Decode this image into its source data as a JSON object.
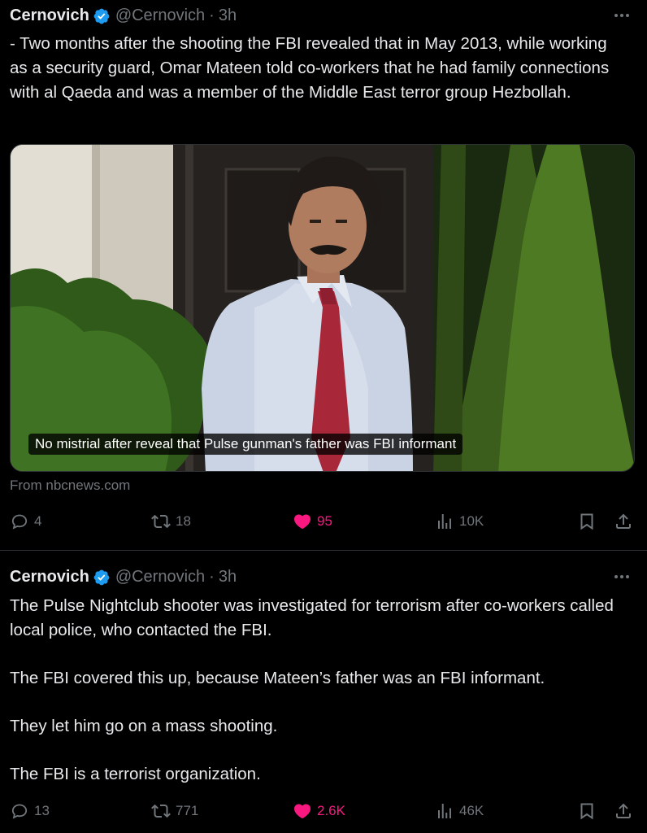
{
  "tweets": [
    {
      "author": {
        "name": "Cernovich",
        "handle": "@Cernovich",
        "separator": "·",
        "time": "3h"
      },
      "text": "- Two months after the shooting the FBI revealed that in May 2013, while working as a security guard, Omar Mateen told co-workers that he had family connections with al Qaeda and was a member of the Middle East terror group Hezbollah.",
      "card": {
        "headline": "No mistrial after reveal that Pulse gunman's father was FBI informant",
        "source": "From nbcnews.com"
      },
      "stats": {
        "replies": "4",
        "retweets": "18",
        "likes": "95",
        "views": "10K"
      }
    },
    {
      "author": {
        "name": "Cernovich",
        "handle": "@Cernovich",
        "separator": "·",
        "time": "3h"
      },
      "paragraphs": [
        "The Pulse Nightclub shooter was investigated for terrorism after co-workers called local police, who contacted the FBI.",
        "The FBI covered this up, because Mateen’s father was an FBI informant.",
        "They let him go on a mass shooting.",
        "The FBI is a terrorist organization."
      ],
      "stats": {
        "replies": "13",
        "retweets": "771",
        "likes": "2.6K",
        "views": "46K"
      }
    }
  ],
  "icons": {
    "verified": "verified-badge-icon",
    "more": "more-horizontal-icon",
    "reply": "reply-bubble-icon",
    "retweet": "retweet-arrows-icon",
    "like": "heart-filled-icon",
    "views": "views-bar-chart-icon",
    "bookmark": "bookmark-icon",
    "share": "share-upload-icon"
  },
  "colors": {
    "background": "#000000",
    "text": "#e7e9ea",
    "muted": "#71767b",
    "verified": "#1d9bf0",
    "like": "#f91880",
    "divider": "#2f3336"
  }
}
